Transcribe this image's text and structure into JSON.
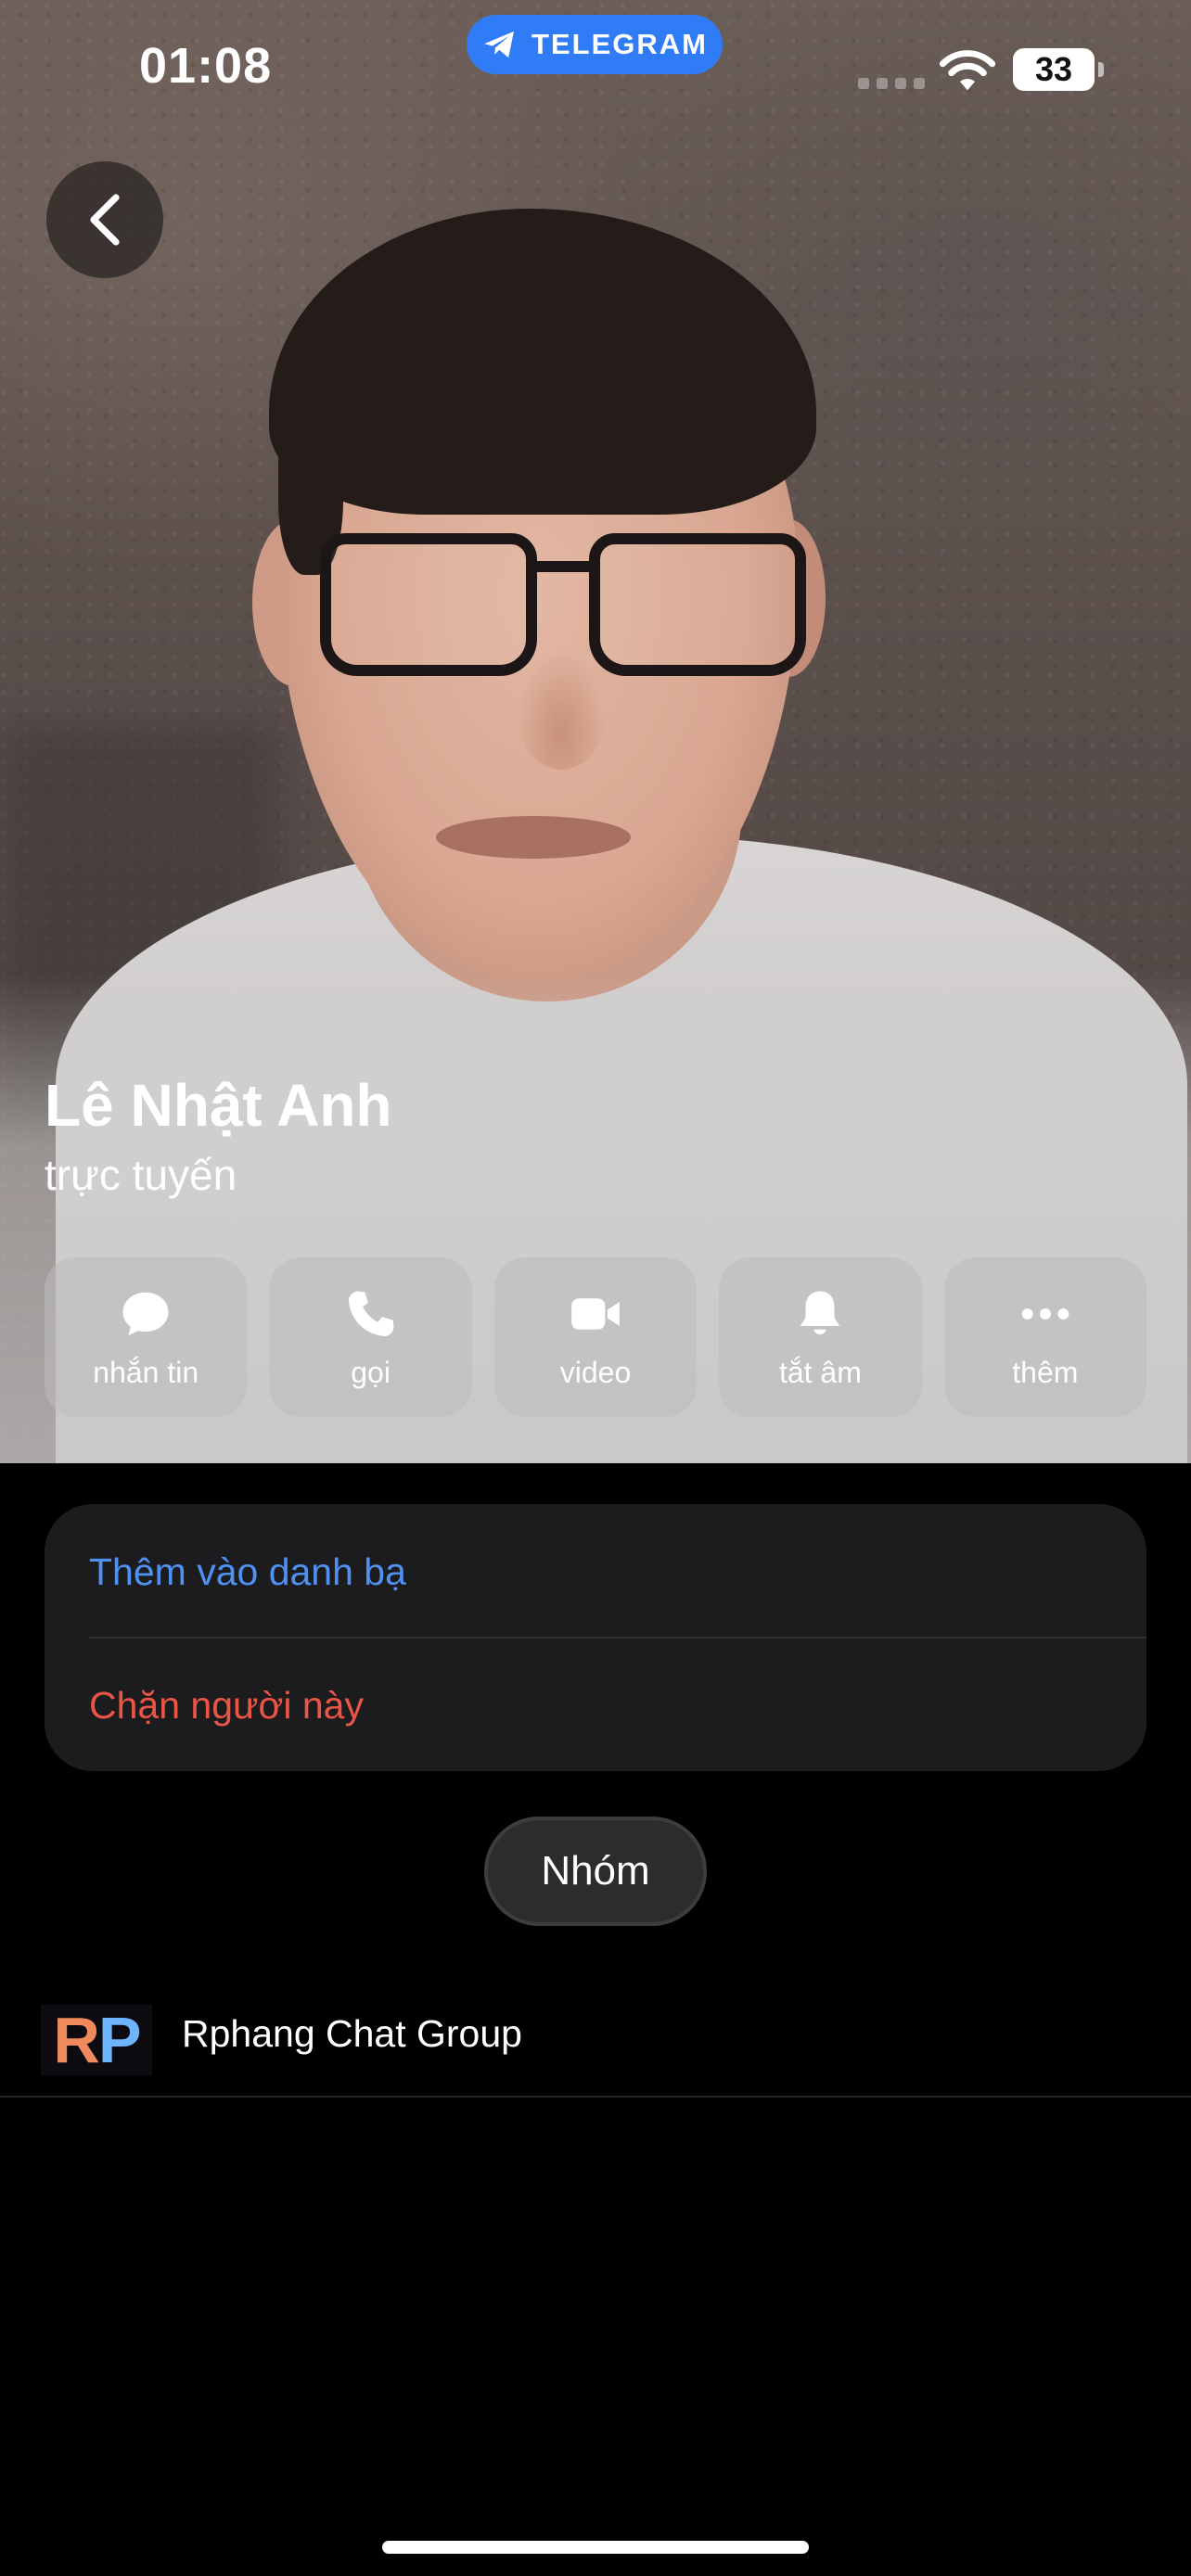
{
  "status_bar": {
    "time": "01:08",
    "app_badge": "TELEGRAM",
    "battery": "33"
  },
  "profile": {
    "name": "Lê Nhật Anh",
    "presence": "trực tuyến"
  },
  "actions": [
    {
      "label": "nhắn tin",
      "icon": "chat-bubble-icon"
    },
    {
      "label": "gọi",
      "icon": "phone-icon"
    },
    {
      "label": "video",
      "icon": "video-camera-icon"
    },
    {
      "label": "tắt âm",
      "icon": "bell-icon"
    },
    {
      "label": "thêm",
      "icon": "more-dots-icon"
    }
  ],
  "card": {
    "add_contact": "Thêm vào danh bạ",
    "block_user": "Chặn người này"
  },
  "tabs": {
    "groups": "Nhóm"
  },
  "groups": [
    {
      "avatar_letters": "RP",
      "name": "Rphang Chat Group"
    }
  ],
  "colors": {
    "accent_blue": "#4f91f2",
    "destructive_red": "#eb5545",
    "telegram_pill": "#2f7cf6",
    "card_bg": "#1c1c1e"
  }
}
